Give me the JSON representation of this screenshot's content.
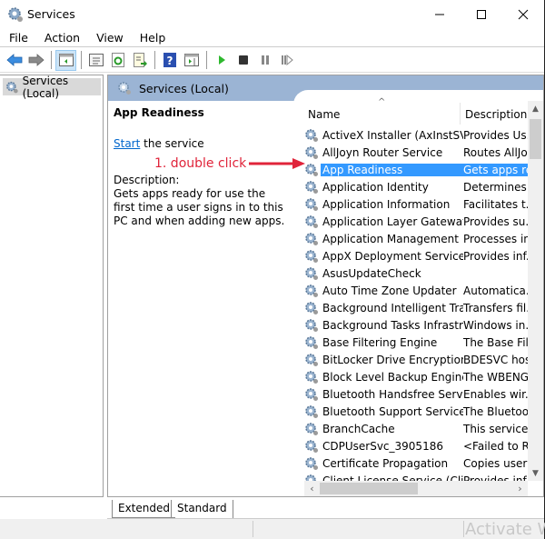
{
  "window": {
    "title": "Services",
    "controls": {
      "minimize": "minimize",
      "maximize": "maximize",
      "close": "close"
    }
  },
  "menu": [
    "File",
    "Action",
    "View",
    "Help"
  ],
  "toolbar": {
    "buttons": [
      "back",
      "forward",
      "show-hide-console-tree",
      "properties",
      "refresh",
      "export-list",
      "help",
      "show-action-pane",
      "start-service",
      "stop-service",
      "pause-service",
      "restart-service"
    ]
  },
  "tree": {
    "root": "Services (Local)"
  },
  "pane_header": "Services (Local)",
  "detail": {
    "service_title": "App Readiness",
    "action_link": "Start",
    "action_suffix": " the service",
    "description_label": "Description:",
    "description": "Gets apps ready for use the first time a user signs in to this PC and when adding new apps."
  },
  "annotation": {
    "text": "1. double click",
    "color": "#e0243a"
  },
  "list": {
    "columns": {
      "name": "Name",
      "description": "Description"
    },
    "selected_index": 2,
    "rows": [
      {
        "name": "ActiveX Installer (AxInstSV)",
        "desc": "Provides Us..."
      },
      {
        "name": "AllJoyn Router Service",
        "desc": "Routes AllJo..."
      },
      {
        "name": "App Readiness",
        "desc": "Gets apps re..."
      },
      {
        "name": "Application Identity",
        "desc": "Determines ..."
      },
      {
        "name": "Application Information",
        "desc": "Facilitates t..."
      },
      {
        "name": "Application Layer Gateway...",
        "desc": "Provides su..."
      },
      {
        "name": "Application Management",
        "desc": "Processes in..."
      },
      {
        "name": "AppX Deployment Service ...",
        "desc": "Provides inf..."
      },
      {
        "name": "AsusUpdateCheck",
        "desc": ""
      },
      {
        "name": "Auto Time Zone Updater",
        "desc": "Automatica..."
      },
      {
        "name": "Background Intelligent Tra...",
        "desc": "Transfers fil..."
      },
      {
        "name": "Background Tasks Infrastr...",
        "desc": "Windows in..."
      },
      {
        "name": "Base Filtering Engine",
        "desc": "The Base Fil..."
      },
      {
        "name": "BitLocker Drive Encryption...",
        "desc": "BDESVC hos..."
      },
      {
        "name": "Block Level Backup Engine...",
        "desc": "The WBENG..."
      },
      {
        "name": "Bluetooth Handsfree Service",
        "desc": "Enables wir..."
      },
      {
        "name": "Bluetooth Support Service",
        "desc": "The Bluetoo..."
      },
      {
        "name": "BranchCache",
        "desc": "This service ..."
      },
      {
        "name": "CDPUserSvc_3905186",
        "desc": "<Failed to R..."
      },
      {
        "name": "Certificate Propagation",
        "desc": "Copies user ..."
      },
      {
        "name": "Client License Service (Cli...",
        "desc": "Provides inf..."
      }
    ]
  },
  "tabs": [
    "Extended",
    "Standard"
  ],
  "active_tab": "Extended",
  "watermark": "Activate W"
}
